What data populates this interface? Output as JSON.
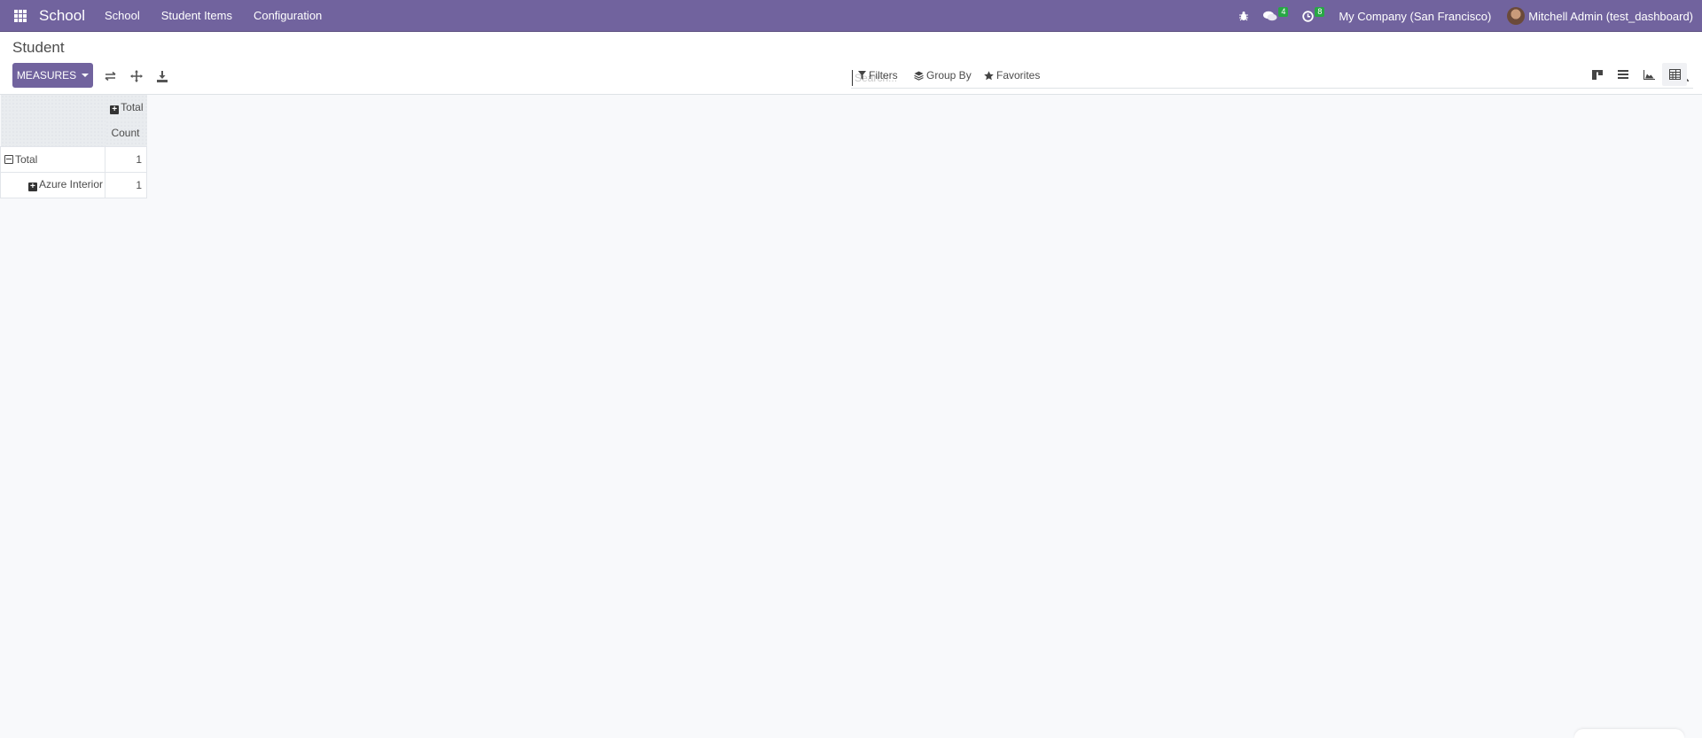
{
  "navbar": {
    "app_name": "School",
    "menus": [
      "School",
      "Student Items",
      "Configuration"
    ],
    "messages_count": "4",
    "activities_count": "8",
    "company": "My Company (San Francisco)",
    "user": "Mitchell Admin (test_dashboard)",
    "brand_color": "#71639e"
  },
  "control_panel": {
    "title": "Student",
    "measures_label": "MEASURES",
    "search_placeholder": "Search...",
    "filters_label": "Filters",
    "group_by_label": "Group By",
    "favorites_label": "Favorites",
    "views": [
      "kanban",
      "list",
      "graph",
      "pivot"
    ],
    "active_view": "pivot"
  },
  "pivot": {
    "col_header": "Total",
    "measure": "Count",
    "rows": [
      {
        "label": "Total",
        "value": "1",
        "expanded": true
      },
      {
        "label": "Azure Interior",
        "value": "1",
        "expanded": false
      }
    ]
  }
}
